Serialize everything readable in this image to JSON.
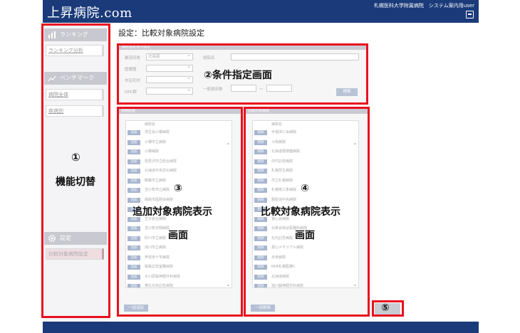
{
  "header": {
    "logo": "上昇病院.com",
    "user_info": "札幌医科大学附属病院　システム案内用user",
    "logout_icon": "logout-icon",
    "color": "#1a3a7a"
  },
  "sidebar": {
    "sections": [
      {
        "title": "ランキング",
        "icon": "bar-chart-icon",
        "items": [
          "ランキング分析"
        ]
      },
      {
        "title": "ベンチマーク",
        "icon": "benchmark-icon",
        "items": [
          "病院全体",
          "疾病別"
        ]
      },
      {
        "title": "設定",
        "icon": "gear-icon",
        "items": [
          "比較対象病院設定"
        ]
      }
    ]
  },
  "page_title": "設定：比較対象病院設定",
  "filter_panel": {
    "header": "病院指定条件設定",
    "prefecture_label": "都道府県",
    "prefecture_value": "北海道",
    "medical_area_label": "医療圏",
    "city_label": "市区町村",
    "dpc_label": "DPC群",
    "hospital_name_label": "病院名",
    "beds_label": "一般病床数",
    "range_sep": "～",
    "search_button": "検索"
  },
  "search_results": {
    "header": "検索結果",
    "column": "病院名",
    "row_button": "追加",
    "rows": [
      "済生会小樽病院",
      "小樽市立病院",
      "小樽病院",
      "岩見沢市立総合病院",
      "北海道中央労災病院",
      "釧路市立病院",
      "苫小牧市立病院",
      "函館市医師会病院",
      "函館五稜郭病院",
      "王子総合病院",
      "苫小牧日翔病院",
      "砂川市立病院",
      "滝川市立病院",
      "伊達赤十字病院",
      "製鉄記念室蘭病院",
      "大川原脳神経外科病院",
      "帯広日赤記念病院"
    ],
    "bulk_button": "一括追加"
  },
  "compare_list": {
    "header": "比較対象病院",
    "column": "病院名",
    "row_button": "削除",
    "rows": [
      "手稲渓仁会病院",
      "斗南病院",
      "北海道循環器病院",
      "中村記念病院",
      "札幌厚生病院",
      "市立札幌病院",
      "札幌南三条病院",
      "勤医協中央病院",
      "KKR札幌医療センター",
      "禎心会病院",
      "北腎会坂泌尿器科病院",
      "北光記念病院",
      "愛心メモリアル病院",
      "天使病院",
      "KKR札幌医療C",
      "北海道病院",
      "旭川脳神経外科病院"
    ],
    "bulk_button": "一括削除"
  },
  "callouts": {
    "c1_num": "①",
    "c1_text": "機能切替",
    "c2_text": "②条件指定画面",
    "c3_num": "③",
    "c3_line1": "追加対象病院表示",
    "c3_line2": "画面",
    "c4_num": "④",
    "c4_line1": "比較対象病院表示",
    "c4_line2": "画面",
    "c5_num": "⑤"
  },
  "colors": {
    "callout_border": "#e8101e",
    "nav_bar": "#1a3a7a",
    "row_button": "#a7b5cf"
  }
}
